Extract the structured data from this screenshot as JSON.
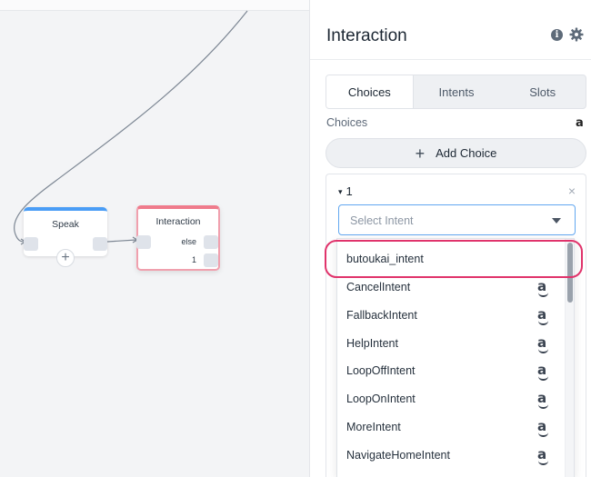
{
  "canvas": {
    "speak_block": {
      "title": "Speak",
      "add_label": "+"
    },
    "interaction_block": {
      "title": "Interaction",
      "ports": [
        "else",
        "1"
      ]
    }
  },
  "panel": {
    "title": "Interaction",
    "info_icon": "info-icon",
    "settings_icon": "gear-icon",
    "tabs": [
      {
        "label": "Choices",
        "active": true
      },
      {
        "label": "Intents",
        "active": false
      },
      {
        "label": "Slots",
        "active": false
      }
    ],
    "section_label": "Choices",
    "add_choice": {
      "icon": "+",
      "label": "Add Choice"
    },
    "choice": {
      "caret": "▾",
      "number": "1",
      "close_icon": "×",
      "select_placeholder": "Select Intent"
    },
    "dropdown": {
      "highlighted_index": 0,
      "highlight_color": "#e0336b",
      "options": [
        {
          "label": "butoukai_intent",
          "amazon": false
        },
        {
          "label": "CancelIntent",
          "amazon": true
        },
        {
          "label": "FallbackIntent",
          "amazon": true
        },
        {
          "label": "HelpIntent",
          "amazon": true
        },
        {
          "label": "LoopOffIntent",
          "amazon": true
        },
        {
          "label": "LoopOnIntent",
          "amazon": true
        },
        {
          "label": "MoreIntent",
          "amazon": true
        },
        {
          "label": "NavigateHomeIntent",
          "amazon": true
        }
      ]
    },
    "amazon_glyph": "a"
  },
  "colors": {
    "speak_accent": "#4a9df6",
    "interaction_accent": "#ef7b8c",
    "focus_border": "#62a7f0"
  }
}
